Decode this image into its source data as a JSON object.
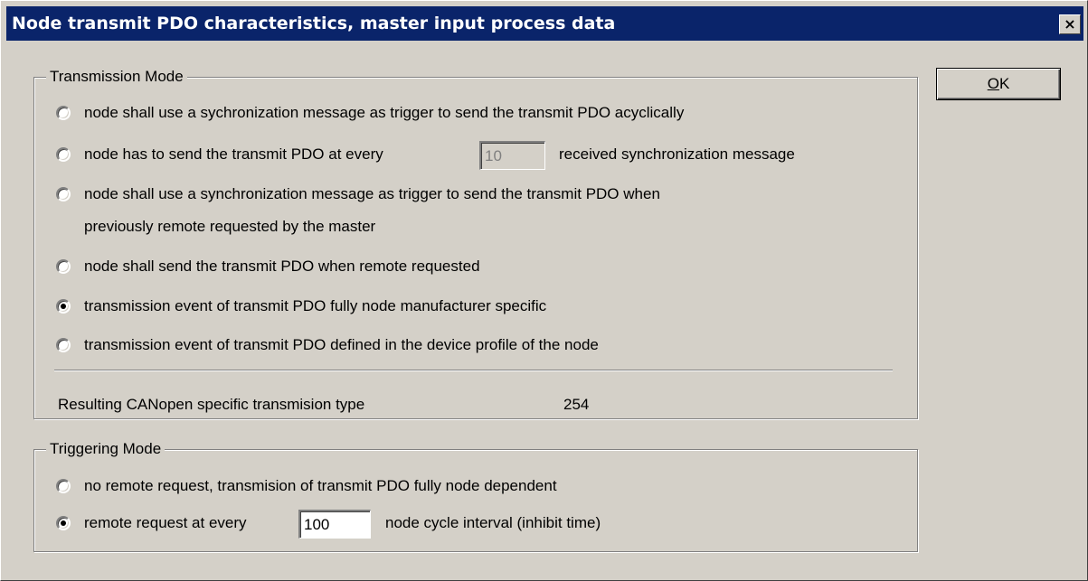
{
  "window": {
    "title": "Node transmit PDO characteristics, master input process data",
    "close_glyph": "×"
  },
  "ok_button": {
    "underlined": "O",
    "rest": "K"
  },
  "transmission_mode": {
    "label": "Transmission Mode",
    "options": [
      {
        "text": "node shall use a sychronization message as trigger to send the transmit PDO acyclically",
        "checked": false
      },
      {
        "text_before": "node has to send the transmit PDO at every",
        "value": "10",
        "text_after": "received synchronization message",
        "checked": false
      },
      {
        "text_line1": "node shall use a synchronization message as trigger to send the transmit PDO when",
        "text_line2": "previously remote requested by the master",
        "checked": false
      },
      {
        "text": "node shall send the transmit PDO when remote requested",
        "checked": false
      },
      {
        "text": "transmission event of transmit PDO fully node manufacturer specific",
        "checked": true
      },
      {
        "text": "transmission event of transmit PDO defined in the device profile of the node",
        "checked": false
      }
    ],
    "result_label": "Resulting CANopen specific transmision type",
    "result_value": "254"
  },
  "triggering_mode": {
    "label": "Triggering Mode",
    "options": [
      {
        "text": "no remote request, transmision of transmit PDO fully node dependent",
        "checked": false
      },
      {
        "text_before": "remote request at every",
        "value": "100",
        "text_after": "node cycle interval (inhibit time)",
        "checked": true
      }
    ]
  }
}
